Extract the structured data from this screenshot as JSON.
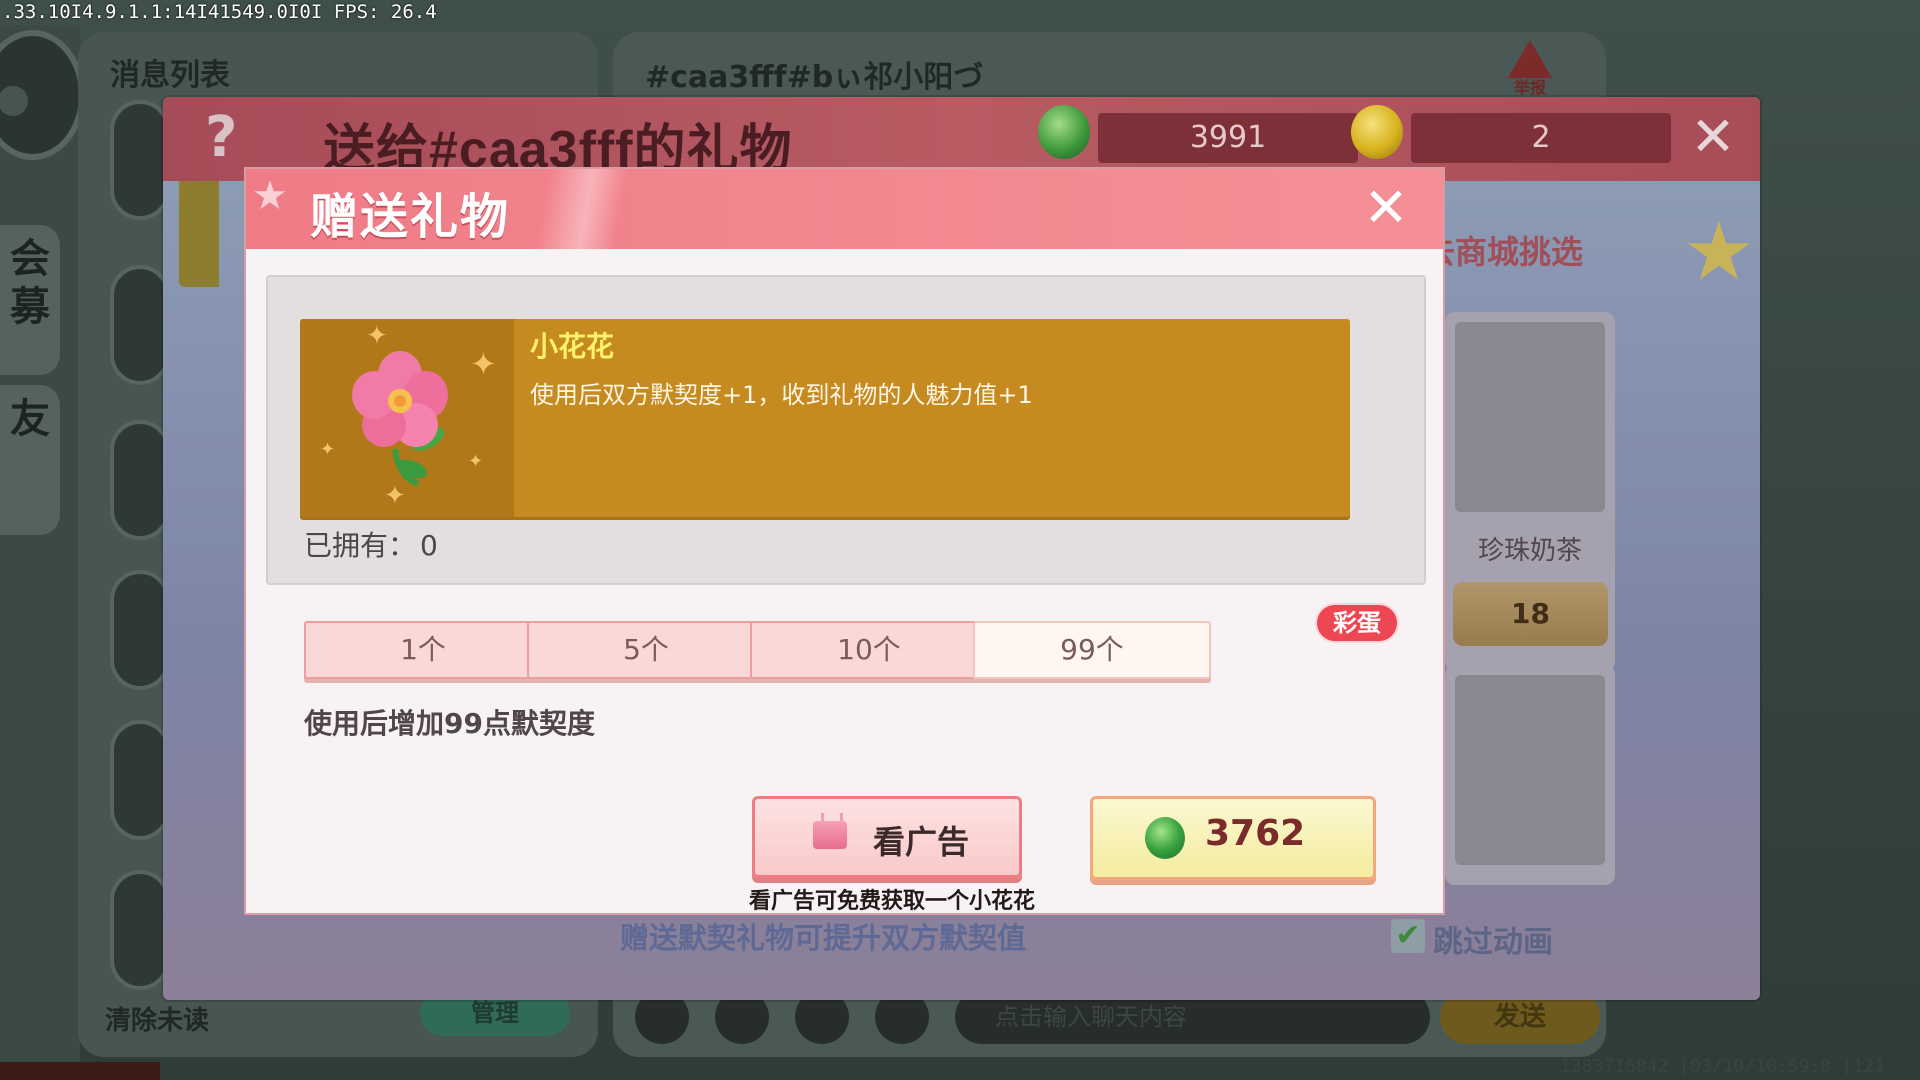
{
  "debug": {
    "text": ".33.10I4.9.1.1:14I41549.0I0I FPS: 26.4"
  },
  "background": {
    "message_list_title": "消息列表",
    "side_tabs": [
      "会\n募",
      "友"
    ],
    "clear_unread": "清除未读",
    "manage": "管理",
    "chat_title": "#caa3fff#bぃ祁小阳づ",
    "report": "举报",
    "input_placeholder": "点击输入聊天内容",
    "send": "发送",
    "footer": "1383716842  [03/10/10:59:0  [121"
  },
  "gift_panel": {
    "help": "?",
    "title": "送给#caa3fff的礼物",
    "currencies": [
      {
        "name": "gem",
        "value": "3991",
        "color": "#3f9a3a"
      },
      {
        "name": "coin",
        "value": "2",
        "color": "#d7b31e"
      }
    ],
    "close": "✕",
    "shop_tab": "去商城挑选",
    "items": [
      {
        "name": "珍珠奶茶",
        "price": "18"
      }
    ],
    "skip_check": "✔",
    "skip_animation": "跳过动画",
    "hint": "赠送默契礼物可提升双方默契值"
  },
  "dialog": {
    "title": "赠送礼物",
    "close": "✕",
    "gift": {
      "name": "小花花",
      "description": "使用后双方默契度+1，收到礼物的人魅力值+1"
    },
    "owned_label": "已拥有：",
    "owned_value": "0",
    "quantities": [
      {
        "label": "1个",
        "selected": false
      },
      {
        "label": "5个",
        "selected": false
      },
      {
        "label": "10个",
        "selected": false
      },
      {
        "label": "99个",
        "selected": true
      }
    ],
    "egg_badge": "彩蛋",
    "quantity_desc": "使用后增加99点默契度",
    "ad_button": "看广告",
    "ad_hint": "看广告可免费获取一个小花花",
    "buy_price": "3762",
    "colors": {
      "header": "#ef7b86",
      "card": "#c58a20",
      "gift_name": "#fdf36a"
    }
  }
}
